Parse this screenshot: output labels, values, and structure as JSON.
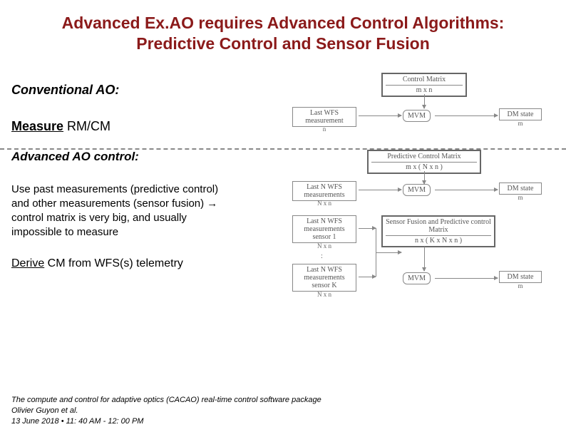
{
  "title": "Advanced Ex.AO requires Advanced Control Algorithms: Predictive Control and Sensor Fusion",
  "conventional_label": "Conventional AO:",
  "measure_word": "Measure",
  "measure_rest": " RM/CM",
  "advanced_label": "Advanced AO control:",
  "body_text": "Use past measurements (predictive control) and other measurements (sensor fusion) → control matrix is very big, and usually impossible to measure",
  "derive_word": "Derive",
  "derive_rest": " CM from WFS(s) telemetry",
  "footer_l1": "The compute and control for adaptive optics (CACAO) real-time control software package",
  "footer_l2": "Olivier Guyon et al.",
  "footer_l3": "13 June 2018 • 11: 40 AM - 12: 00 PM",
  "diagram": {
    "control_matrix": "Control Matrix",
    "control_matrix_sub": "m x n",
    "last_wfs": "Last WFS measurement",
    "last_wfs_sub": "n",
    "mvm": "MVM",
    "dm_state": "DM state",
    "dm_state_sub": "m",
    "pred_matrix": "Predictive Control Matrix",
    "pred_matrix_sub": "m x ( N x n )",
    "last_n_wfs": "Last N WFS measurements",
    "last_n_wfs_sub": "N x n",
    "sensor1": "Last N WFS measurements sensor 1",
    "sensor1_sub": "N x n",
    "sensorK": "Last N WFS measurements sensor K",
    "sensorK_sub": "N x n",
    "fusion": "Sensor Fusion and Predictive control Matrix",
    "fusion_sub": "n x ( K x N x n )",
    "dots": ":"
  }
}
